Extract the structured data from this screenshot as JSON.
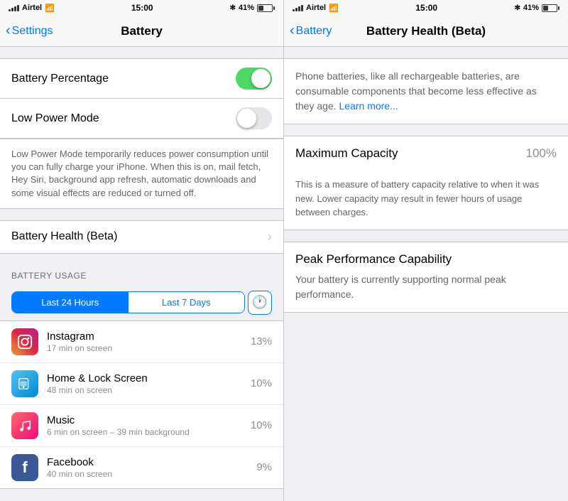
{
  "left": {
    "statusBar": {
      "carrier": "Airtel",
      "time": "15:00",
      "battery": "41%"
    },
    "navBar": {
      "backLabel": "Settings",
      "title": "Battery"
    },
    "settings": {
      "rows": [
        {
          "label": "Battery Percentage",
          "toggle": true,
          "on": true
        },
        {
          "label": "Low Power Mode",
          "toggle": true,
          "on": false
        }
      ],
      "description": "Low Power Mode temporarily reduces power consumption until you can fully charge your iPhone. When this is on, mail fetch, Hey Siri, background app refresh, automatic downloads and some visual effects are reduced or turned off.",
      "healthRow": "Battery Health (Beta)"
    },
    "batteryUsage": {
      "sectionLabel": "BATTERY USAGE",
      "tabs": [
        "Last 24 Hours",
        "Last 7 Days"
      ],
      "activeTab": 0,
      "apps": [
        {
          "name": "Instagram",
          "time": "17 min on screen",
          "percent": "13%",
          "icon": "instagram"
        },
        {
          "name": "Home & Lock Screen",
          "time": "48 min on screen",
          "percent": "10%",
          "icon": "homescreen"
        },
        {
          "name": "Music",
          "time": "6 min on screen – 39 min background",
          "percent": "10%",
          "icon": "music"
        },
        {
          "name": "Facebook",
          "time": "40 min on screen",
          "percent": "9%",
          "icon": "facebook"
        }
      ]
    }
  },
  "right": {
    "statusBar": {
      "carrier": "Airtel",
      "time": "15:00",
      "battery": "41%"
    },
    "navBar": {
      "backLabel": "Battery",
      "title": "Battery Health (Beta)"
    },
    "introText": "Phone batteries, like all rechargeable batteries, are consumable components that become less effective as they age.",
    "learnMore": "Learn more...",
    "maxCapacity": {
      "label": "Maximum Capacity",
      "value": "100%"
    },
    "maxCapacityDesc": "This is a measure of battery capacity relative to when it was new. Lower capacity may result in fewer hours of usage between charges.",
    "peakPerformance": {
      "title": "Peak Performance Capability",
      "desc": "Your battery is currently supporting normal peak performance."
    }
  }
}
